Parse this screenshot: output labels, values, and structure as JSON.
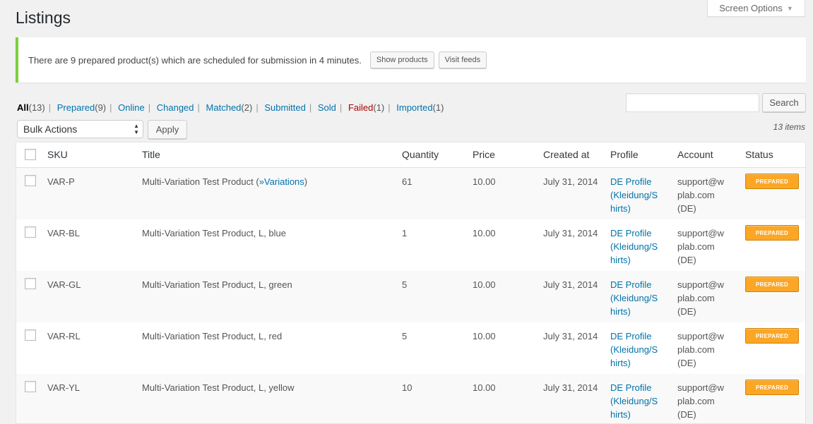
{
  "screen_options": {
    "label": "Screen Options",
    "arrow": "▼"
  },
  "page": {
    "title": "Listings"
  },
  "notice": {
    "text": "There are 9 prepared product(s) which are scheduled for submission in 4 minutes.",
    "show_products": "Show products",
    "visit_feeds": "Visit feeds"
  },
  "filters": [
    {
      "label": "All",
      "count": "(13)"
    },
    {
      "label": "Prepared",
      "count": "(9)"
    },
    {
      "label": "Online",
      "count": ""
    },
    {
      "label": "Changed",
      "count": ""
    },
    {
      "label": "Matched",
      "count": "(2)"
    },
    {
      "label": "Submitted",
      "count": ""
    },
    {
      "label": "Sold",
      "count": ""
    },
    {
      "label": "Failed",
      "count": "(1)"
    },
    {
      "label": "Imported",
      "count": "(1)"
    }
  ],
  "search": {
    "placeholder": "",
    "button": "Search"
  },
  "bulk": {
    "selected": "Bulk Actions",
    "apply": "Apply"
  },
  "items_count": "13 items",
  "columns": {
    "sku": "SKU",
    "title": "Title",
    "quantity": "Quantity",
    "price": "Price",
    "created": "Created at",
    "profile": "Profile",
    "account": "Account",
    "status": "Status"
  },
  "rows": [
    {
      "sku": "VAR-P",
      "title": "Multi-Variation Test Product (",
      "title_link": "»Variations",
      "title_suffix": ")",
      "quantity": "61",
      "price": "10.00",
      "created": "July 31, 2014",
      "profile": [
        "DE Profile",
        "(Kleidung/S",
        "hirts)"
      ],
      "account": [
        "support@w",
        "plab.com",
        "(DE)"
      ],
      "status": "PREPARED"
    },
    {
      "sku": "VAR-BL",
      "title": "Multi-Variation Test Product, L, blue",
      "title_link": "",
      "title_suffix": "",
      "quantity": "1",
      "price": "10.00",
      "created": "July 31, 2014",
      "profile": [
        "DE Profile",
        "(Kleidung/S",
        "hirts)"
      ],
      "account": [
        "support@w",
        "plab.com",
        "(DE)"
      ],
      "status": "PREPARED"
    },
    {
      "sku": "VAR-GL",
      "title": "Multi-Variation Test Product, L, green",
      "title_link": "",
      "title_suffix": "",
      "quantity": "5",
      "price": "10.00",
      "created": "July 31, 2014",
      "profile": [
        "DE Profile",
        "(Kleidung/S",
        "hirts)"
      ],
      "account": [
        "support@w",
        "plab.com",
        "(DE)"
      ],
      "status": "PREPARED"
    },
    {
      "sku": "VAR-RL",
      "title": "Multi-Variation Test Product, L, red",
      "title_link": "",
      "title_suffix": "",
      "quantity": "5",
      "price": "10.00",
      "created": "July 31, 2014",
      "profile": [
        "DE Profile",
        "(Kleidung/S",
        "hirts)"
      ],
      "account": [
        "support@w",
        "plab.com",
        "(DE)"
      ],
      "status": "PREPARED"
    },
    {
      "sku": "VAR-YL",
      "title": "Multi-Variation Test Product, L, yellow",
      "title_link": "",
      "title_suffix": "",
      "quantity": "10",
      "price": "10.00",
      "created": "July 31, 2014",
      "profile": [
        "DE Profile",
        "(Kleidung/S",
        "hirts)"
      ],
      "account": [
        "support@w",
        "plab.com",
        "(DE)"
      ],
      "status": "PREPARED"
    }
  ],
  "colors": {
    "accent_link": "#0073aa",
    "notice_border": "#7ad03a",
    "failed": "#aa0000",
    "badge_bg": "#fba625"
  }
}
